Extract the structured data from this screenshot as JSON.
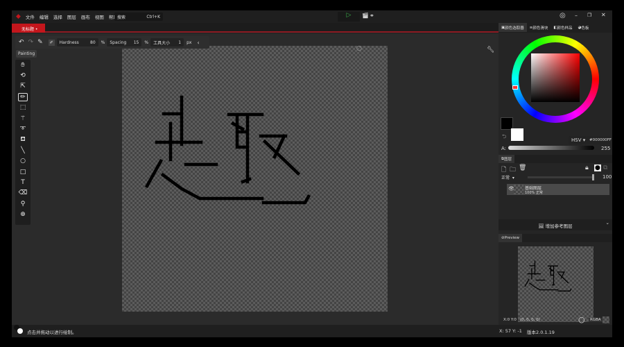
{
  "menu": [
    "文件",
    "编辑",
    "选择",
    "图层",
    "画布",
    "视图",
    "帮助"
  ],
  "search": {
    "label": "搜索",
    "shortcut": "Ctrl+K"
  },
  "document_tab": "无标题 •",
  "toolbar": {
    "hardness_label": "Hardness",
    "hardness": "80",
    "hardness_unit": "%",
    "spacing_label": "Spacing",
    "spacing": "15",
    "spacing_unit": "%",
    "size_label": "工具大小",
    "size": "1",
    "size_unit": "px"
  },
  "mode_badge": "Painting",
  "tools": [
    "hand-icon",
    "rotate-icon",
    "select-arrow-icon",
    "pencil-icon",
    "rect-select-icon",
    "magic-wand-icon",
    "lasso-icon",
    "fill-bucket-icon",
    "line-icon",
    "ellipse-icon",
    "rectangle-icon",
    "text-icon",
    "eraser-icon",
    "eyedropper-icon",
    "zoom-icon"
  ],
  "right_tabs": [
    "颜色选取器",
    "颜色滑块",
    "颜色样品",
    "色板"
  ],
  "color": {
    "mode": "HSV",
    "hex": "#000000FF",
    "alpha_label": "A:",
    "alpha": "255",
    "foreground": "#000000",
    "background": "#ffffff"
  },
  "layers": {
    "tab": "图层",
    "blend": "正常",
    "opacity": "100",
    "items": [
      {
        "name": "基础图层",
        "info": "100%  正常"
      }
    ],
    "add_reference": "增加参考图层"
  },
  "preview_tab": "Preview",
  "pixel_info": {
    "coords": "X:0 Y:0",
    "rgba": "(0, 0, 0, 0)",
    "mode": "RGBA"
  },
  "status": {
    "hint": "点击并拖动以进行绘制。",
    "cursor": "X: 57 Y: -1",
    "version": "版本2.0.1.19"
  },
  "colors": {
    "accent": "#c4161c",
    "play": "#3cb44b"
  }
}
